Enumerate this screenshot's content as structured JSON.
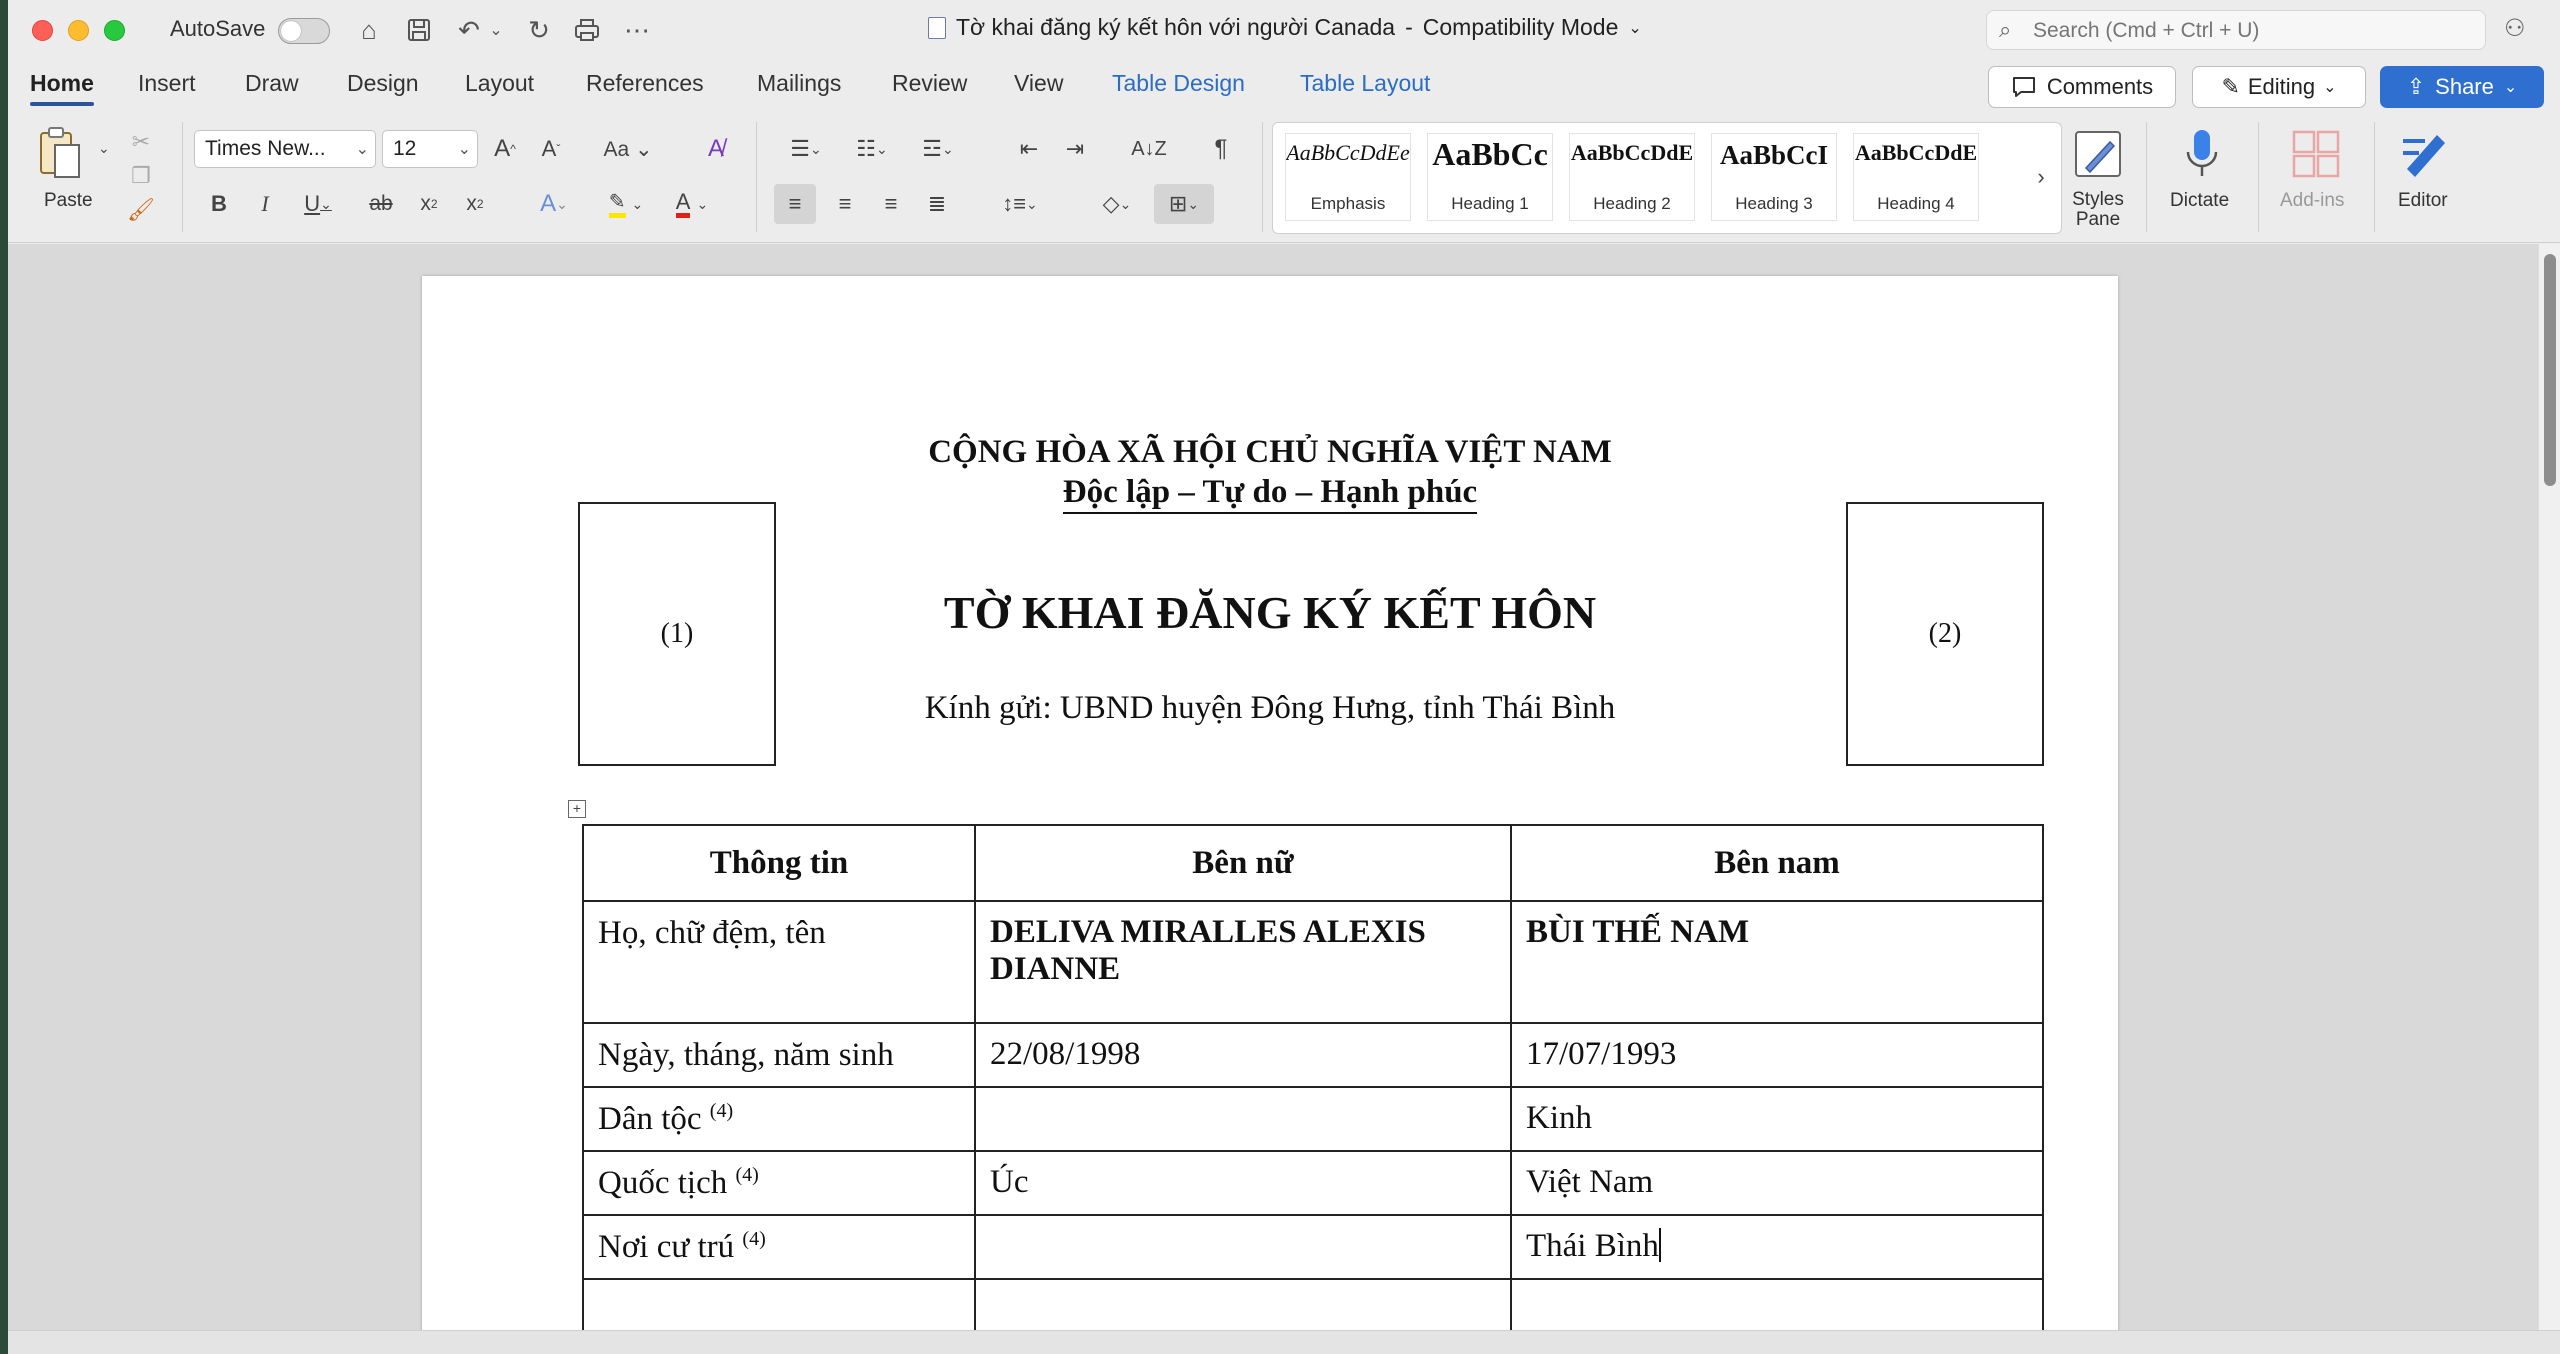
{
  "titlebar": {
    "autosave_label": "AutoSave",
    "doc_title": "Tờ khai đăng ký kết hôn với người Canada",
    "separator": " - ",
    "mode": "Compatibility Mode",
    "search_placeholder": "Search (Cmd + Ctrl + U)"
  },
  "tabs": [
    "Home",
    "Insert",
    "Draw",
    "Design",
    "Layout",
    "References",
    "Mailings",
    "Review",
    "View",
    "Table Design",
    "Table Layout"
  ],
  "actions": {
    "comments": "Comments",
    "editing": "Editing",
    "share": "Share"
  },
  "ribbon": {
    "paste_label": "Paste",
    "font_name": "Times New...",
    "font_size": "12",
    "styles": [
      {
        "sample": "AaBbCcDdEe",
        "name": "Emphasis"
      },
      {
        "sample": "AaBbCc",
        "name": "Heading 1"
      },
      {
        "sample": "AaBbCcDdE",
        "name": "Heading 2"
      },
      {
        "sample": "AaBbCcI",
        "name": "Heading 3"
      },
      {
        "sample": "AaBbCcDdE",
        "name": "Heading 4"
      }
    ],
    "styles_pane_label": "Styles Pane",
    "dictate_label": "Dictate",
    "addins_label": "Add-ins",
    "editor_label": "Editor"
  },
  "document": {
    "header_line1": "CỘNG HÒA XÃ HỘI CHỦ NGHĨA VIỆT NAM",
    "header_line2": "Độc lập – Tự do – Hạnh phúc",
    "photo_left": "(1)",
    "photo_right": "(2)",
    "title": "TỜ KHAI ĐĂNG KÝ KẾT HÔN",
    "addressee": "Kính gửi: UBND huyện Đông Hưng, tỉnh Thái Bình",
    "table": {
      "headers": [
        "Thông tin",
        "Bên nữ",
        "Bên nam"
      ],
      "rows": [
        {
          "label": "Họ, chữ đệm, tên",
          "sup": "",
          "female": "DELIVA MIRALLES ALEXIS DIANNE",
          "male": "BÙI THẾ NAM"
        },
        {
          "label": "Ngày, tháng, năm sinh",
          "sup": "",
          "female": "22/08/1998",
          "male": "17/07/1993"
        },
        {
          "label": "Dân tộc ",
          "sup": "(4)",
          "female": "",
          "male": "Kinh"
        },
        {
          "label": "Quốc tịch ",
          "sup": "(4)",
          "female": "Úc",
          "male": "Việt Nam"
        },
        {
          "label": "Nơi cư trú ",
          "sup": "(4)",
          "female": "",
          "male": "Thái Bình"
        }
      ]
    }
  }
}
